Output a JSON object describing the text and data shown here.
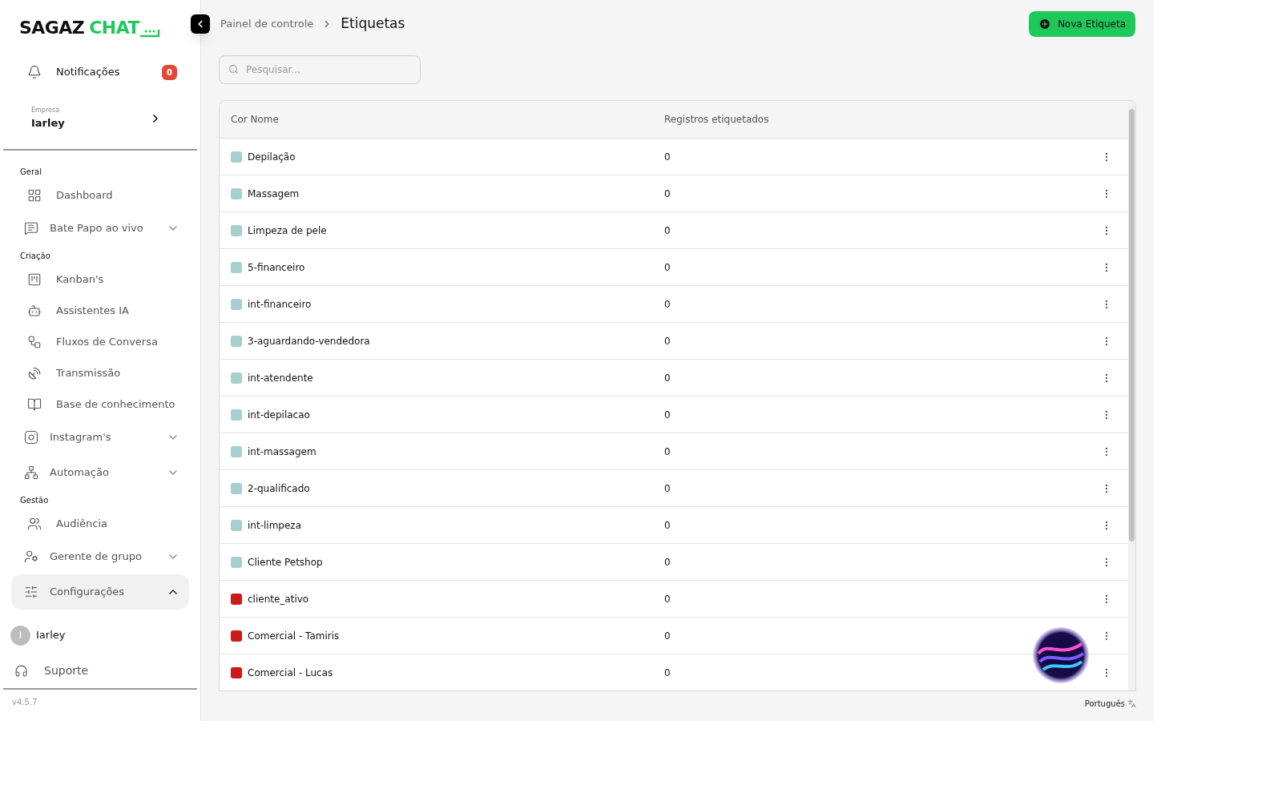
{
  "logo": {
    "first": "SAGAZ",
    "second": "CHAT"
  },
  "notifications": {
    "label": "Notificações",
    "count": "0"
  },
  "company": {
    "caption": "Empresa",
    "name": "Iarley"
  },
  "nav": [
    {
      "heading": "Geral",
      "items": [
        {
          "label": "Dashboard",
          "kind": "link",
          "selected": false
        },
        {
          "label": "Bate Papo ao vivo",
          "kind": "group",
          "expanded": false,
          "selected": false
        }
      ]
    },
    {
      "heading": "Criação",
      "items": [
        {
          "label": "Kanban's",
          "kind": "link",
          "selected": false
        },
        {
          "label": "Assistentes IA",
          "kind": "link",
          "selected": false
        },
        {
          "label": "Fluxos de Conversa",
          "kind": "link",
          "selected": false
        },
        {
          "label": "Transmissão",
          "kind": "link",
          "selected": false
        },
        {
          "label": "Base de conhecimento",
          "kind": "link",
          "selected": false
        },
        {
          "label": "Instagram's",
          "kind": "group",
          "expanded": false,
          "selected": false
        },
        {
          "label": "Automação",
          "kind": "group",
          "expanded": false,
          "selected": false
        }
      ]
    },
    {
      "heading": "Gestão",
      "items": [
        {
          "label": "Audiência",
          "kind": "link",
          "selected": false
        },
        {
          "label": "Gerente de grupo",
          "kind": "group",
          "expanded": false,
          "selected": false
        },
        {
          "label": "Configurações",
          "kind": "group",
          "expanded": true,
          "selected": true
        }
      ]
    }
  ],
  "user": {
    "initial": "I",
    "name": "Iarley"
  },
  "support": "Suporte",
  "version": "v4.5.7",
  "breadcrumb": [
    "Painel de controle",
    "Etiquetas"
  ],
  "new_button": "Nova Etiqueta",
  "search": {
    "placeholder": "Pesquisar..."
  },
  "table": {
    "columns": [
      "Cor Nome",
      "Registros etiquetados"
    ],
    "rows": [
      {
        "name": "Depilação",
        "count": "0",
        "color": "#a7cfcf"
      },
      {
        "name": "Massagem",
        "count": "0",
        "color": "#a7cfcf"
      },
      {
        "name": "Limpeza de pele",
        "count": "0",
        "color": "#a7cfcf"
      },
      {
        "name": "5-financeiro",
        "count": "0",
        "color": "#a7cfcf"
      },
      {
        "name": "int-financeiro",
        "count": "0",
        "color": "#a7cfcf"
      },
      {
        "name": "3-aguardando-vendedora",
        "count": "0",
        "color": "#a7cfcf"
      },
      {
        "name": "int-atendente",
        "count": "0",
        "color": "#a7cfcf"
      },
      {
        "name": "int-depilacao",
        "count": "0",
        "color": "#a7cfcf"
      },
      {
        "name": "int-massagem",
        "count": "0",
        "color": "#a7cfcf"
      },
      {
        "name": "2-qualificado",
        "count": "0",
        "color": "#a7cfcf"
      },
      {
        "name": "int-limpeza",
        "count": "0",
        "color": "#a7cfcf"
      },
      {
        "name": "Cliente Petshop",
        "count": "0",
        "color": "#a7cfcf"
      },
      {
        "name": "cliente_ativo",
        "count": "0",
        "color": "#cc1a1a"
      },
      {
        "name": "Comercial - Tamiris",
        "count": "0",
        "color": "#cc1a1a"
      },
      {
        "name": "Comercial - Lucas",
        "count": "0",
        "color": "#cc1a1a"
      }
    ]
  },
  "language": "Português"
}
